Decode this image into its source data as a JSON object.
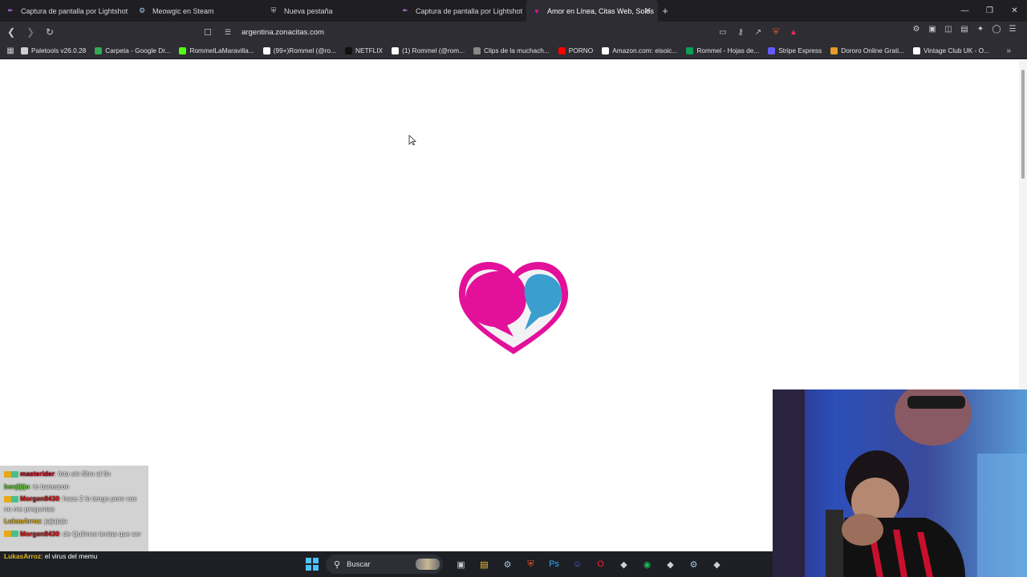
{
  "tabs": [
    {
      "title": "Captura de pantalla por Lightshot",
      "icon": "feather-icon"
    },
    {
      "title": "Meowgic en Steam",
      "icon": "steam-icon"
    },
    {
      "title": "Nueva pestaña",
      "icon": "shield-icon"
    },
    {
      "title": "Captura de pantalla por Lightshot",
      "icon": "feather-icon"
    },
    {
      "title": "Amor en Línea, Citas Web, Solos",
      "icon": "heart-chat-icon",
      "active": true
    }
  ],
  "address_bar": {
    "url": "argentina.zonacitas.com"
  },
  "bookmarks": [
    {
      "label": "Paletools v26.0.28",
      "color": "#cfcfcf"
    },
    {
      "label": "Carpeta - Google Dr...",
      "color": "#34a853"
    },
    {
      "label": "RommelLaMaravilla...",
      "color": "#53fc18"
    },
    {
      "label": "(99+)Rommel (@ro...",
      "color": "#ffffff"
    },
    {
      "label": "NETFLIX",
      "color": "#111111"
    },
    {
      "label": "(1) Rommel (@rom...",
      "color": "#ffffff"
    },
    {
      "label": "Clips de la muchach...",
      "color": "#888888"
    },
    {
      "label": "PORNO",
      "color": "#ff0000"
    },
    {
      "label": "Amazon.com: eisoic...",
      "color": "#ffffff"
    },
    {
      "label": "Rommel - Hojas de...",
      "color": "#0f9d58"
    },
    {
      "label": "Stripe Express",
      "color": "#635bff"
    },
    {
      "label": "Dororo Online Grati...",
      "color": "#e39b2a"
    },
    {
      "label": "Vintage Club UK - O...",
      "color": "#ffffff"
    }
  ],
  "chat": [
    {
      "user": "masterider",
      "text": "foto sin filtro al fin",
      "badge": true,
      "style": "u1"
    },
    {
      "user": "benjijijo",
      "text": "te banearon",
      "badge": false,
      "style": "u2"
    },
    {
      "user": "Morgen8430",
      "text": "hace 2 lo tengo pero vos no me preguntas",
      "badge": true,
      "style": "u3"
    },
    {
      "user": "LukasArroz",
      "text": "jajjajaja",
      "badge": false,
      "style": "u4"
    },
    {
      "user": "Morgen8430",
      "text": "de Quilmes tenias que ser",
      "badge": true,
      "style": "u3"
    }
  ],
  "chat_last": {
    "user": "LukasArroz",
    "text": "el virus del memu"
  },
  "taskbar": {
    "search_label": "Buscar",
    "apps": [
      "task-view-icon",
      "file-explorer-icon",
      "steam-icon",
      "brave-icon",
      "photoshop-icon",
      "discord-icon",
      "opera-icon",
      "app-icon",
      "spotify-icon",
      "app-icon",
      "steam-icon",
      "app-icon"
    ]
  },
  "colors": {
    "logo_magenta": "#e3109a",
    "logo_blue": "#3a9ecf",
    "tab_bg": "#1f1f23",
    "toolbar_bg": "#2d2d33"
  }
}
